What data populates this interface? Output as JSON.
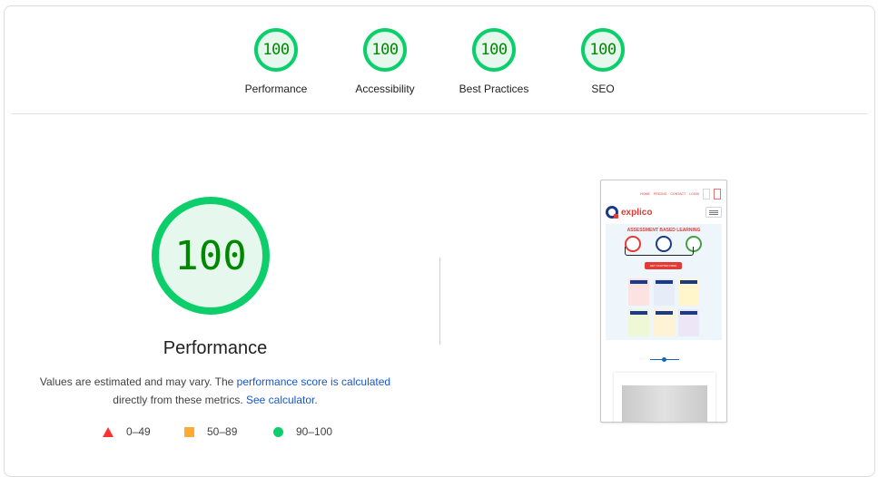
{
  "summary_gauges": [
    {
      "score": "100",
      "label": "Performance"
    },
    {
      "score": "100",
      "label": "Accessibility"
    },
    {
      "score": "100",
      "label": "Best Practices"
    },
    {
      "score": "100",
      "label": "SEO"
    }
  ],
  "performance": {
    "score": "100",
    "title": "Performance",
    "desc_pre": "Values are estimated and may vary. The ",
    "desc_link1": "performance score is calculated",
    "desc_mid": "directly from these metrics. ",
    "desc_link2": "See calculator",
    "desc_post": "."
  },
  "legend": [
    {
      "range": "0–49",
      "shape": "triangle",
      "color": "#ff3333"
    },
    {
      "range": "50–89",
      "shape": "square",
      "color": "#ffaa33"
    },
    {
      "range": "90–100",
      "shape": "circle",
      "color": "#0cce6b"
    }
  ],
  "thumbnail": {
    "nav": [
      "HOME",
      "PRICING",
      "CONTACT",
      "LOGIN"
    ],
    "logo_text": "explico",
    "hero_title": "ASSESSMENT BASED LEARNING",
    "cta": "GET STARTED FREE"
  },
  "colors": {
    "pass": "#0cce6b",
    "pass_text": "#008800",
    "pass_bg": "#e6f8ee",
    "link": "#1a56c9"
  }
}
